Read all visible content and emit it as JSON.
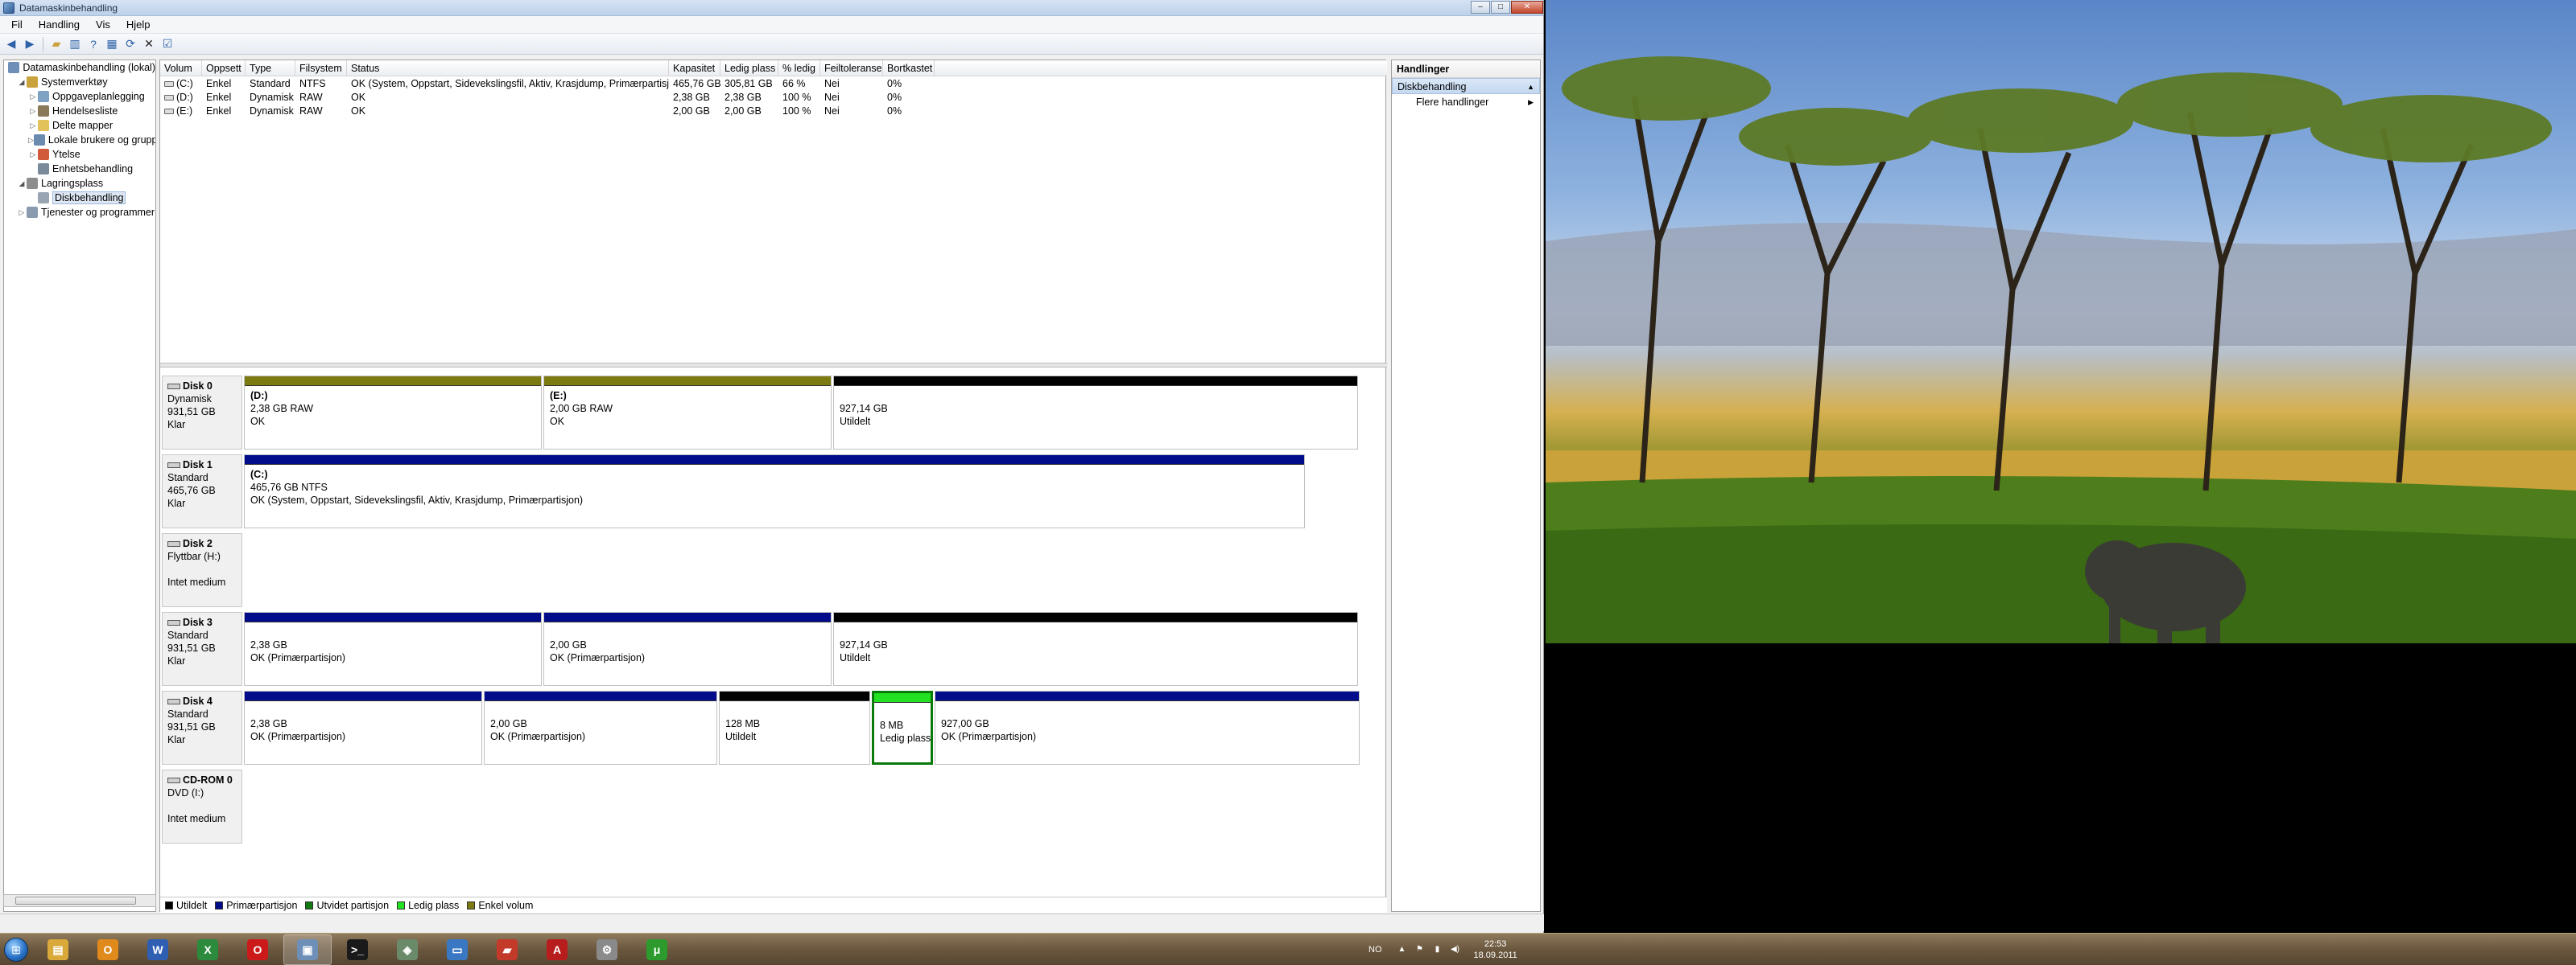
{
  "window": {
    "title": "Datamaskinbehandling",
    "minimize": "–",
    "maximize": "□",
    "close": "✕"
  },
  "menu": [
    "Fil",
    "Handling",
    "Vis",
    "Hjelp"
  ],
  "tree": {
    "items": [
      {
        "label": "Datamaskinbehandling (lokal)",
        "indent": 0,
        "expander": "",
        "icon": "computer-management-icon",
        "color": "#6d8fb8"
      },
      {
        "label": "Systemverktøy",
        "indent": 1,
        "expander": "◢",
        "icon": "tools-icon",
        "color": "#c9a23b"
      },
      {
        "label": "Oppgaveplanlegging",
        "indent": 2,
        "expander": "▷",
        "icon": "clock-icon",
        "color": "#7ea2c4"
      },
      {
        "label": "Hendelsesliste",
        "indent": 2,
        "expander": "▷",
        "icon": "event-log-icon",
        "color": "#8a7a5a"
      },
      {
        "label": "Delte mapper",
        "indent": 2,
        "expander": "▷",
        "icon": "folder-icon",
        "color": "#e2c25a"
      },
      {
        "label": "Lokale brukere og grupper",
        "indent": 2,
        "expander": "▷",
        "icon": "users-icon",
        "color": "#6a8ab0"
      },
      {
        "label": "Ytelse",
        "indent": 2,
        "expander": "▷",
        "icon": "performance-icon",
        "color": "#d05a3a"
      },
      {
        "label": "Enhetsbehandling",
        "indent": 2,
        "expander": "",
        "icon": "device-manager-icon",
        "color": "#7b8a9a"
      },
      {
        "label": "Lagringsplass",
        "indent": 1,
        "expander": "◢",
        "icon": "storage-icon",
        "color": "#8d8d8d"
      },
      {
        "label": "Diskbehandling",
        "indent": 2,
        "expander": "",
        "icon": "disk-management-icon",
        "color": "#9aa5b3",
        "selected": true
      },
      {
        "label": "Tjenester og programmer",
        "indent": 1,
        "expander": "▷",
        "icon": "services-icon",
        "color": "#8a9bb0"
      }
    ]
  },
  "volumes": {
    "headers": [
      "Volum",
      "Oppsett",
      "Type",
      "Filsystem",
      "Status",
      "Kapasitet",
      "Ledig plass",
      "% ledig",
      "Feiltoleranse",
      "Bortkastet"
    ],
    "rows": [
      [
        "(C:)",
        "Enkel",
        "Standard",
        "NTFS",
        "OK (System, Oppstart, Sidevekslingsfil, Aktiv, Krasjdump, Primærpartisjon)",
        "465,76 GB",
        "305,81 GB",
        "66 %",
        "Nei",
        "0%"
      ],
      [
        "(D:)",
        "Enkel",
        "Dynamisk",
        "RAW",
        "OK",
        "2,38 GB",
        "2,38 GB",
        "100 %",
        "Nei",
        "0%"
      ],
      [
        "(E:)",
        "Enkel",
        "Dynamisk",
        "RAW",
        "OK",
        "2,00 GB",
        "2,00 GB",
        "100 %",
        "Nei",
        "0%"
      ]
    ]
  },
  "colors": {
    "unallocated": "#000000",
    "primary": "#000c8a",
    "extended": "#117a11",
    "free": "#22e022",
    "simple": "#7b7b12"
  },
  "disks": [
    {
      "name": "Disk 0",
      "lines": [
        "Dynamisk",
        "931,51 GB",
        "Klar"
      ],
      "parts": [
        {
          "kind": "simple",
          "name": "(D:)",
          "size": "2,38 GB RAW",
          "status": "OK"
        },
        {
          "kind": "simple",
          "name": "(E:)",
          "size": "2,00 GB RAW",
          "status": "OK"
        },
        {
          "kind": "unallocated",
          "name": "",
          "size": "927,14 GB",
          "status": "Utildelt"
        }
      ]
    },
    {
      "name": "Disk 1",
      "lines": [
        "Standard",
        "465,76 GB",
        "Klar"
      ],
      "parts": [
        {
          "kind": "primary",
          "name": "(C:)",
          "size": "465,76 GB NTFS",
          "status": "OK (System, Oppstart, Sidevekslingsfil, Aktiv, Krasjdump, Primærpartisjon)"
        }
      ]
    },
    {
      "name": "Disk 2",
      "lines": [
        "Flyttbar (H:)",
        "",
        "Intet medium"
      ],
      "parts": []
    },
    {
      "name": "Disk 3",
      "lines": [
        "Standard",
        "931,51 GB",
        "Klar"
      ],
      "parts": [
        {
          "kind": "primary",
          "name": "",
          "size": "2,38 GB",
          "status": "OK (Primærpartisjon)"
        },
        {
          "kind": "primary",
          "name": "",
          "size": "2,00 GB",
          "status": "OK (Primærpartisjon)"
        },
        {
          "kind": "unallocated",
          "name": "",
          "size": "927,14 GB",
          "status": "Utildelt"
        }
      ]
    },
    {
      "name": "Disk 4",
      "lines": [
        "Standard",
        "931,51 GB",
        "Klar"
      ],
      "parts": [
        {
          "kind": "primary",
          "name": "",
          "size": "2,38 GB",
          "status": "OK (Primærpartisjon)"
        },
        {
          "kind": "primary",
          "name": "",
          "size": "2,00 GB",
          "status": "OK (Primærpartisjon)"
        },
        {
          "kind": "unallocated",
          "name": "",
          "size": "128 MB",
          "status": "Utildelt"
        },
        {
          "kind": "free",
          "name": "",
          "size": "8 MB",
          "status": "Ledig plass"
        },
        {
          "kind": "primary",
          "name": "",
          "size": "927,00 GB",
          "status": "OK (Primærpartisjon)"
        }
      ]
    },
    {
      "name": "CD-ROM 0",
      "lines": [
        "DVD (I:)",
        "",
        "Intet medium"
      ],
      "parts": []
    }
  ],
  "legend": [
    {
      "kind": "unallocated",
      "label": "Utildelt"
    },
    {
      "kind": "primary",
      "label": "Primærpartisjon"
    },
    {
      "kind": "extended",
      "label": "Utvidet partisjon"
    },
    {
      "kind": "free",
      "label": "Ledig plass"
    },
    {
      "kind": "simple",
      "label": "Enkel volum"
    }
  ],
  "actions": {
    "header": "Handlinger",
    "section": "Diskbehandling",
    "section_caret": "▲",
    "more": "Flere handlinger",
    "more_arrow": "▶"
  },
  "taskbar": {
    "apps": [
      {
        "name": "explorer-taskbar-button",
        "icon": "folder-icon",
        "glyph": "▤",
        "color": "#d9a93a"
      },
      {
        "name": "outlook-taskbar-button",
        "icon": "outlook-icon",
        "glyph": "O",
        "color": "#e08a1c"
      },
      {
        "name": "word-taskbar-button",
        "icon": "word-icon",
        "glyph": "W",
        "color": "#2f5fb3"
      },
      {
        "name": "excel-taskbar-button",
        "icon": "excel-icon",
        "glyph": "X",
        "color": "#2c8a3c"
      },
      {
        "name": "opera-taskbar-button",
        "icon": "opera-icon",
        "glyph": "O",
        "color": "#cc1a1a"
      },
      {
        "name": "computer-management-taskbar-button",
        "icon": "computer-management-icon",
        "glyph": "▣",
        "color": "#6d8fb8",
        "active": true
      },
      {
        "name": "terminal-taskbar-button",
        "icon": "terminal-icon",
        "glyph": ">_",
        "color": "#1a1a1a"
      },
      {
        "name": "network-taskbar-button",
        "icon": "network-icon",
        "glyph": "◈",
        "color": "#6b8a6a"
      },
      {
        "name": "remote-desktop-taskbar-button",
        "icon": "remote-desktop-icon",
        "glyph": "▭",
        "color": "#3a78c4"
      },
      {
        "name": "truck-taskbar-button",
        "icon": "truck-icon",
        "glyph": "▰",
        "color": "#c43a2a"
      },
      {
        "name": "acrobat-taskbar-button",
        "icon": "acrobat-icon",
        "glyph": "A",
        "color": "#b81d1d"
      },
      {
        "name": "settings-taskbar-button",
        "icon": "gear-icon",
        "glyph": "⚙",
        "color": "#8a8a8a"
      },
      {
        "name": "utorrent-taskbar-button",
        "icon": "utorrent-icon",
        "glyph": "μ",
        "color": "#2d9a2d"
      }
    ],
    "lang": "NO",
    "time": "22:53",
    "date": "18.09.2011"
  }
}
